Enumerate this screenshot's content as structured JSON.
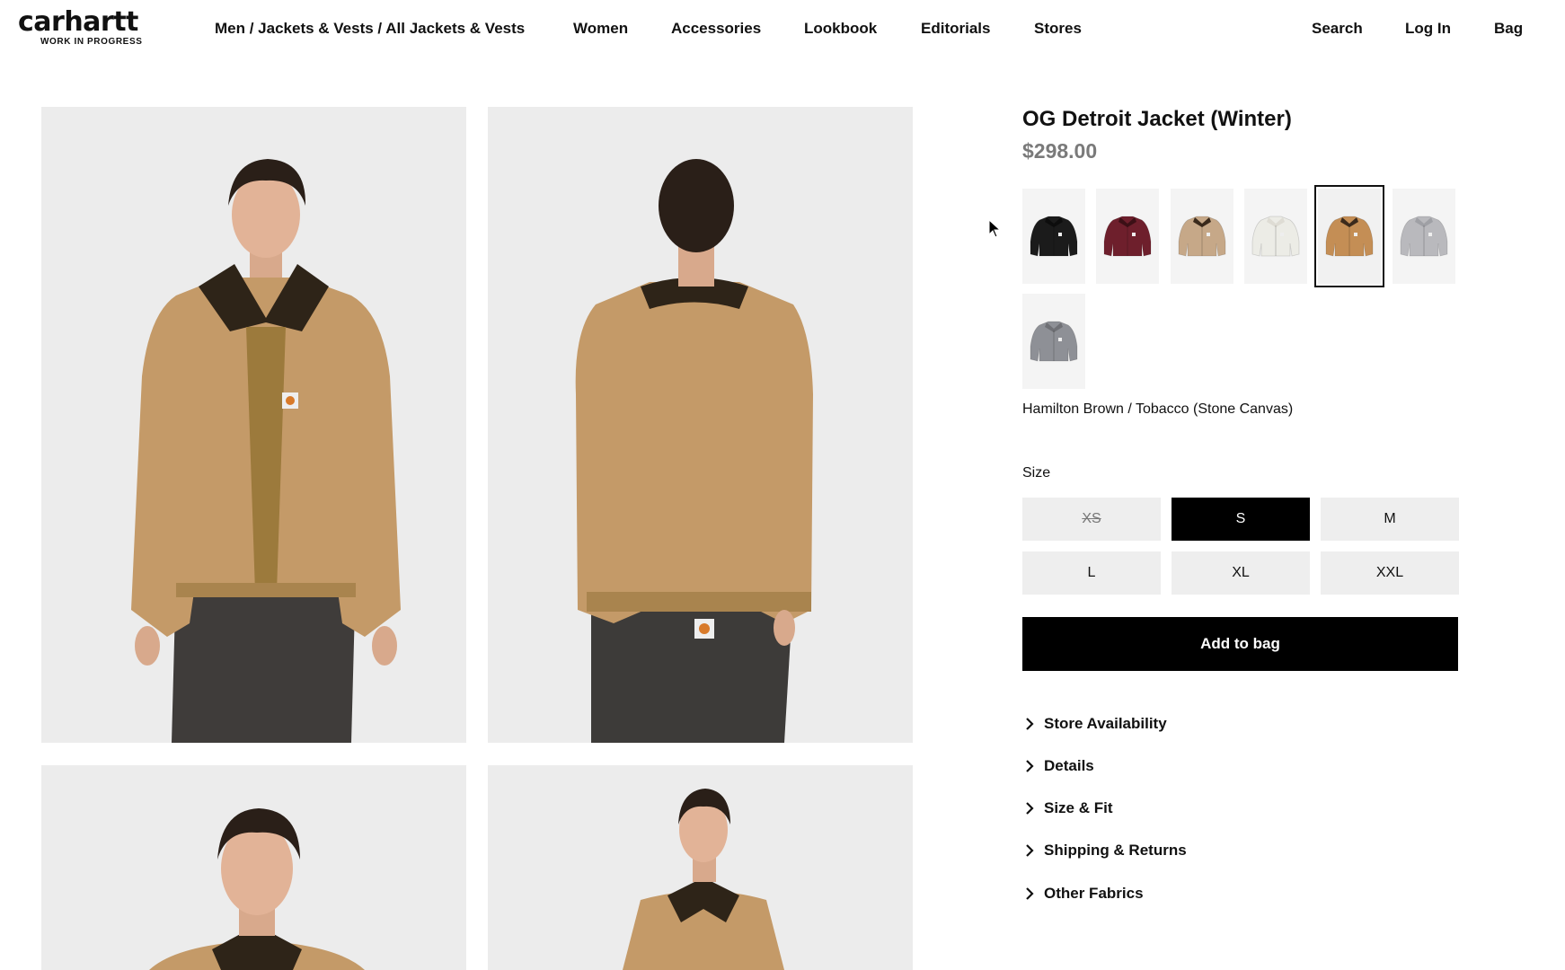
{
  "brand": {
    "logo_text": "carhartt",
    "logo_sub": "WORK IN PROGRESS"
  },
  "nav": {
    "breadcrumb": "Men / Jackets & Vests / All Jackets & Vests",
    "items": [
      "Women",
      "Accessories",
      "Lookbook",
      "Editorials",
      "Stores"
    ],
    "right": {
      "search": "Search",
      "login": "Log In",
      "bag": "Bag"
    }
  },
  "gallery": {
    "images": [
      {
        "name": "front-view",
        "view": "front"
      },
      {
        "name": "back-view",
        "view": "back"
      },
      {
        "name": "detail-view-1",
        "view": "portrait"
      },
      {
        "name": "detail-view-2",
        "view": "portrait-far"
      }
    ]
  },
  "product": {
    "title": "OG Detroit Jacket (Winter)",
    "price": "$298.00",
    "color_name": "Hamilton Brown / Tobacco (Stone Canvas)",
    "swatches": [
      {
        "name": "black",
        "body": "#1b1b1b",
        "collar": "#0d0d0d",
        "selected": false
      },
      {
        "name": "burgundy",
        "body": "#6e1f2c",
        "collar": "#3c1016",
        "selected": false
      },
      {
        "name": "dusty-hamilton",
        "body": "#c6a888",
        "collar": "#3a2a1c",
        "selected": false
      },
      {
        "name": "wax",
        "body": "#ecece6",
        "collar": "#dedcd4",
        "selected": false
      },
      {
        "name": "hamilton-brown-tobacco",
        "body": "#c48e55",
        "collar": "#3b2a1c",
        "selected": true
      },
      {
        "name": "light-grey",
        "body": "#b9b9bd",
        "collar": "#9fa0a5",
        "selected": false
      },
      {
        "name": "grey",
        "body": "#8e9096",
        "collar": "#6f7075",
        "selected": false
      }
    ],
    "size_label": "Size",
    "sizes": [
      {
        "label": "XS",
        "state": "unavailable"
      },
      {
        "label": "S",
        "state": "selected"
      },
      {
        "label": "M",
        "state": "available"
      },
      {
        "label": "L",
        "state": "available"
      },
      {
        "label": "XL",
        "state": "available"
      },
      {
        "label": "XXL",
        "state": "available"
      }
    ],
    "add_to_bag": "Add to bag",
    "accordions": [
      "Store Availability",
      "Details",
      "Size & Fit",
      "Shipping & Returns",
      "Other Fabrics"
    ]
  },
  "colors": {
    "accent": "#000000",
    "image_bg": "#ececec",
    "price": "#7a7a7a"
  }
}
